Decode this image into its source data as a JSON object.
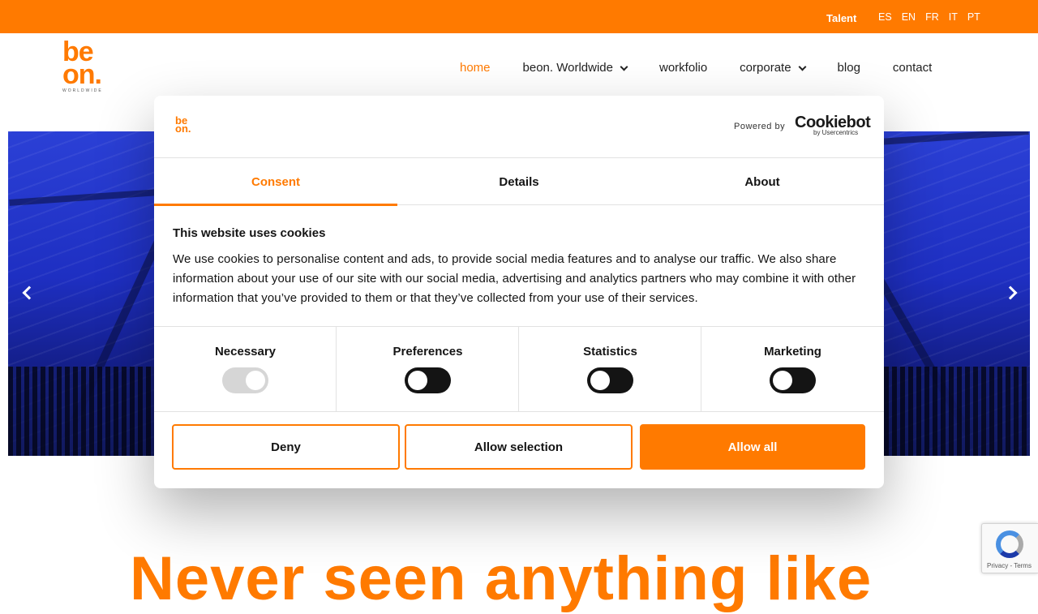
{
  "topbar": {
    "talent": "Talent",
    "languages": [
      "ES",
      "EN",
      "FR",
      "IT",
      "PT"
    ]
  },
  "header": {
    "logo_line1": "be",
    "logo_line2": "on.",
    "logo_sub": "WORLDWIDE",
    "nav": [
      {
        "label": "home",
        "active": true
      },
      {
        "label": "beon. Worldwide",
        "dropdown": true
      },
      {
        "label": "workfolio"
      },
      {
        "label": "corporate",
        "dropdown": true
      },
      {
        "label": "blog"
      },
      {
        "label": "contact"
      }
    ]
  },
  "hero": {
    "headline": "Never seen anything like"
  },
  "dialog": {
    "logo_line1": "be",
    "logo_line2": "on.",
    "powered_by": "Powered by",
    "cookiebot": "Cookiebot",
    "cookiebot_sub": "by Usercentrics",
    "tabs": [
      {
        "label": "Consent",
        "active": true
      },
      {
        "label": "Details"
      },
      {
        "label": "About"
      }
    ],
    "title": "This website uses cookies",
    "text": "We use cookies to personalise content and ads, to provide social media features and to analyse our traffic. We also share information about your use of our site with our social media, advertising and analytics partners who may combine it with other information that you’ve provided to them or that they’ve collected from your use of their services.",
    "categories": [
      {
        "label": "Necessary",
        "state": "on-disabled"
      },
      {
        "label": "Preferences",
        "state": "off"
      },
      {
        "label": "Statistics",
        "state": "off"
      },
      {
        "label": "Marketing",
        "state": "off"
      }
    ],
    "buttons": {
      "deny": "Deny",
      "allow_selection": "Allow selection",
      "allow_all": "Allow all"
    }
  },
  "recaptcha": {
    "text": "Privacy - Terms"
  },
  "colors": {
    "brand_orange": "#ff7a00",
    "dark": "#141414"
  }
}
